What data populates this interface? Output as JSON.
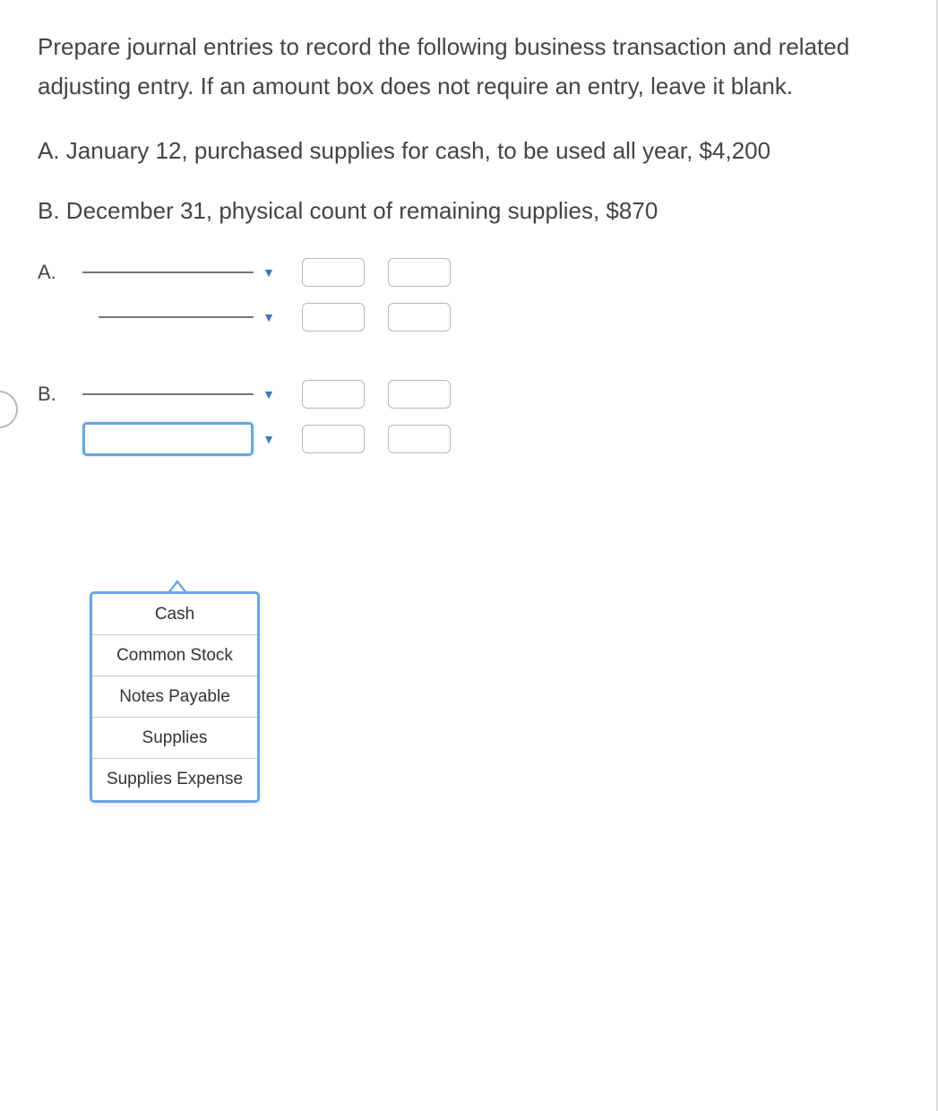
{
  "instructions": "Prepare journal entries to record the following business transaction and related adjusting entry. If an amount box does not require an entry, leave it blank.",
  "transactions": {
    "a": "A. January 12, purchased supplies for cash, to be used all year, $4,200",
    "b": "B. December 31, physical count of remaining supplies, $870"
  },
  "labels": {
    "a": "A.",
    "b": "B."
  },
  "entries": {
    "a": {
      "row1": {
        "account": "",
        "debit": "",
        "credit": ""
      },
      "row2": {
        "account": "",
        "debit": "",
        "credit": ""
      }
    },
    "b": {
      "row1": {
        "account": "",
        "debit": "",
        "credit": ""
      },
      "row2": {
        "account": "",
        "debit": "",
        "credit": ""
      }
    }
  },
  "dropdown_options": [
    "Cash",
    "Common Stock",
    "Notes Payable",
    "Supplies",
    "Supplies Expense"
  ]
}
